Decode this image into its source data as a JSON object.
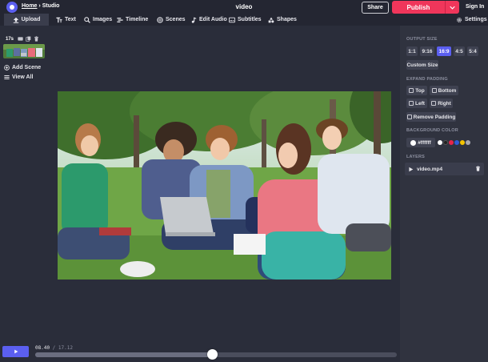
{
  "topbar": {
    "breadcrumb_home": "Home",
    "breadcrumb_sep": " › ",
    "breadcrumb_current": "Studio",
    "project_title": "video",
    "share_label": "Share",
    "publish_label": "Publish",
    "signin_label": "Sign In"
  },
  "toolbar": {
    "upload": "Upload",
    "text": "Text",
    "images": "Images",
    "timeline": "Timeline",
    "scenes": "Scenes",
    "edit_audio": "Edit Audio",
    "subtitles": "Subtitles",
    "shapes": "Shapes",
    "settings": "Settings"
  },
  "scenes": {
    "duration": "17s",
    "add_scene": "Add Scene",
    "view_all": "View All"
  },
  "right_panel": {
    "output_size_title": "OUTPUT SIZE",
    "ratios": [
      "1:1",
      "9:16",
      "16:9",
      "4:5",
      "5:4"
    ],
    "selected_ratio": "16:9",
    "custom_size": "Custom Size",
    "expand_padding_title": "EXPAND PADDING",
    "padding_top": "Top",
    "padding_bottom": "Bottom",
    "padding_left": "Left",
    "padding_right": "Right",
    "remove_padding": "Remove Padding",
    "bg_color_title": "BACKGROUND COLOR",
    "bg_color_value": "#ffffff",
    "palette": [
      "#ffffff",
      "#222222",
      "#e8254a",
      "#2f5bd8",
      "#f5c400",
      "#a8a8b0"
    ],
    "layers_title": "LAYERS",
    "layer_name": "video.mp4"
  },
  "timeline": {
    "current_time": "08.40",
    "separator": " / ",
    "total_time": "17.12",
    "progress": 0.49
  },
  "colors": {
    "accent": "#5b5ff0",
    "publish": "#f0365b",
    "background": "#2a2d3a"
  }
}
